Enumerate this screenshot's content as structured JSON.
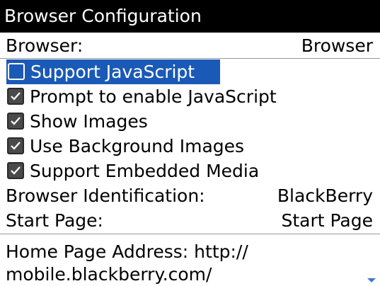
{
  "title": "Browser Configuration",
  "browser": {
    "label": "Browser:",
    "value": "Browser"
  },
  "checkboxes": [
    {
      "label": "Support JavaScript",
      "checked": false,
      "focused": true
    },
    {
      "label": "Prompt to enable JavaScript",
      "checked": true
    },
    {
      "label": "Show Images",
      "checked": true
    },
    {
      "label": "Use Background Images",
      "checked": true
    },
    {
      "label": "Support Embedded Media",
      "checked": true
    }
  ],
  "identification": {
    "label": "Browser Identification:",
    "value": "BlackBerry"
  },
  "start_page": {
    "label": "Start Page:",
    "value": "Start Page"
  },
  "home_page": {
    "text": "Home Page Address: http:// mobile.blackberry.com/"
  },
  "colors": {
    "accent": "#1a5ab6",
    "titlebar": "#000000"
  },
  "icons": {
    "checkmark": "check-icon",
    "scroll": "scroll-down-indicator-icon"
  }
}
